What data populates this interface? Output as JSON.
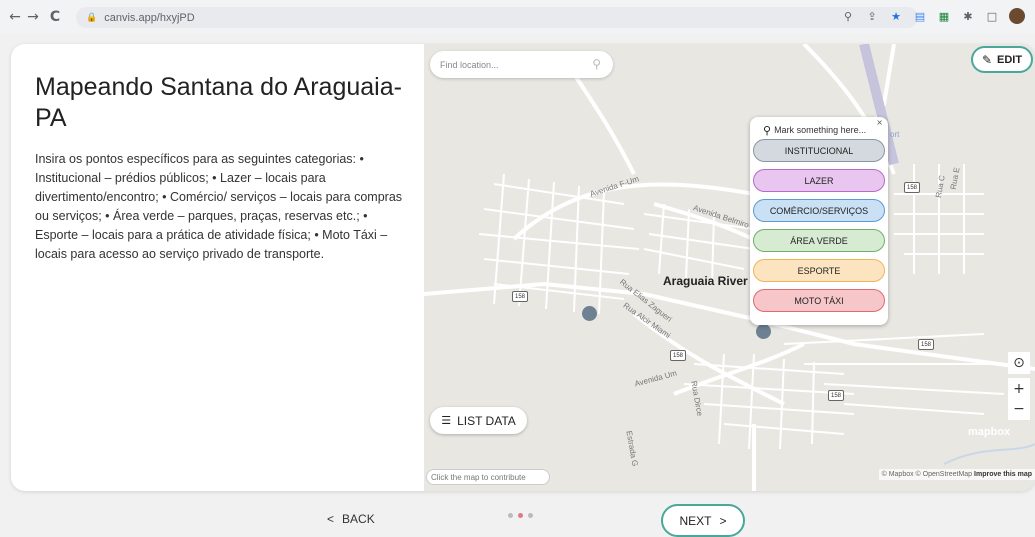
{
  "browser": {
    "back": "←",
    "forward": "→",
    "reload": "C",
    "url": "canvis.app/hxyjPD",
    "lock": "🔒"
  },
  "left": {
    "title": "Mapeando Santana do Araguaia-PA",
    "description": "Insira os pontos específicos para as seguintes categorias: • Institucional – prédios públicos; • Lazer – locais para divertimento/encontro; • Comércio/ serviços – locais para compras ou serviços; • Área verde – parques, praças, reservas etc.; • Esporte – locais para a prática de atividade física; • Moto Táxi – locais para acesso ao serviço privado de transporte."
  },
  "map": {
    "search_placeholder": "Find location...",
    "edit_label": "EDIT",
    "river_label": "Araguaia River",
    "street_labels": [
      "Avenida F-Um",
      "Avenida Belmiro",
      "Rua Elias Zagueri",
      "Rua Alcir Miami",
      "Avenida Um",
      "Rua Dirce",
      "Estrada G",
      "Rua E",
      "Rua C",
      "ort"
    ],
    "route_number": "158",
    "popup": {
      "header": "Mark something here...",
      "close": "×",
      "categories": [
        {
          "label": "INSTITUCIONAL",
          "bg": "#d3d9de",
          "border": "#8a96a0"
        },
        {
          "label": "LAZER",
          "bg": "#e8c6ef",
          "border": "#b66bc6"
        },
        {
          "label": "COMÉRCIO/SERVIÇOS",
          "bg": "#c9e0f5",
          "border": "#5b9bd5"
        },
        {
          "label": "ÁREA VERDE",
          "bg": "#d7ebd3",
          "border": "#6db163"
        },
        {
          "label": "ESPORTE",
          "bg": "#fde4c1",
          "border": "#f0b35a"
        },
        {
          "label": "MOTO TÁXI",
          "bg": "#f6c6c8",
          "border": "#e06a70"
        }
      ]
    },
    "list_data_label": "LIST DATA",
    "contribute_hint": "Click the map to contribute",
    "zoom_in": "+",
    "zoom_out": "−",
    "locate": "⊙",
    "mapbox_logo": "mapbox",
    "attribution_plain": "© Mapbox © OpenStreetMap",
    "attribution_link": "Improve this map"
  },
  "footer": {
    "back_label": "BACK",
    "back_icon": "<",
    "next_label": "NEXT",
    "next_icon": ">",
    "page_dots": 3,
    "active_dot": 1
  }
}
